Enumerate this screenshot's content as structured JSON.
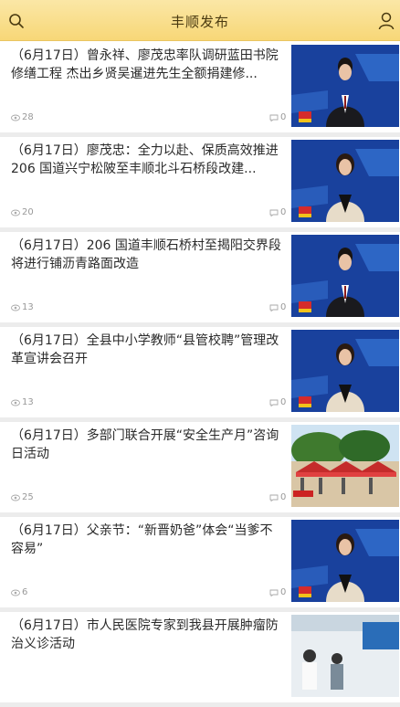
{
  "header": {
    "title": "丰顺发布"
  },
  "articles": [
    {
      "headline": "（6月17日）曾永祥、廖茂忠率队调研蓝田书院修缮工程 杰出乡贤吴暹进先生全额捐建修...",
      "views": "28",
      "comments": "0",
      "thumb": "anchor-male"
    },
    {
      "headline": "（6月17日）廖茂忠：全力以赴、保质高效推进 206 国道兴宁松陂至丰顺北斗石桥段改建...",
      "views": "20",
      "comments": "0",
      "thumb": "anchor-female"
    },
    {
      "headline": "（6月17日）206 国道丰顺石桥村至揭阳交界段将进行铺沥青路面改造",
      "views": "13",
      "comments": "0",
      "thumb": "anchor-male"
    },
    {
      "headline": "（6月17日）全县中小学教师“县管校聘”管理改革宣讲会召开",
      "views": "13",
      "comments": "0",
      "thumb": "anchor-female"
    },
    {
      "headline": "（6月17日）多部门联合开展“安全生产月”咨询日活动",
      "views": "25",
      "comments": "0",
      "thumb": "outdoor-tents"
    },
    {
      "headline": "（6月17日）父亲节：“新晋奶爸”体会“当爹不容易”",
      "views": "6",
      "comments": "0",
      "thumb": "anchor-female"
    },
    {
      "headline": "（6月17日）市人民医院专家到我县开展肿瘤防治义诊活动",
      "views": "",
      "comments": "",
      "thumb": "clinic"
    }
  ]
}
